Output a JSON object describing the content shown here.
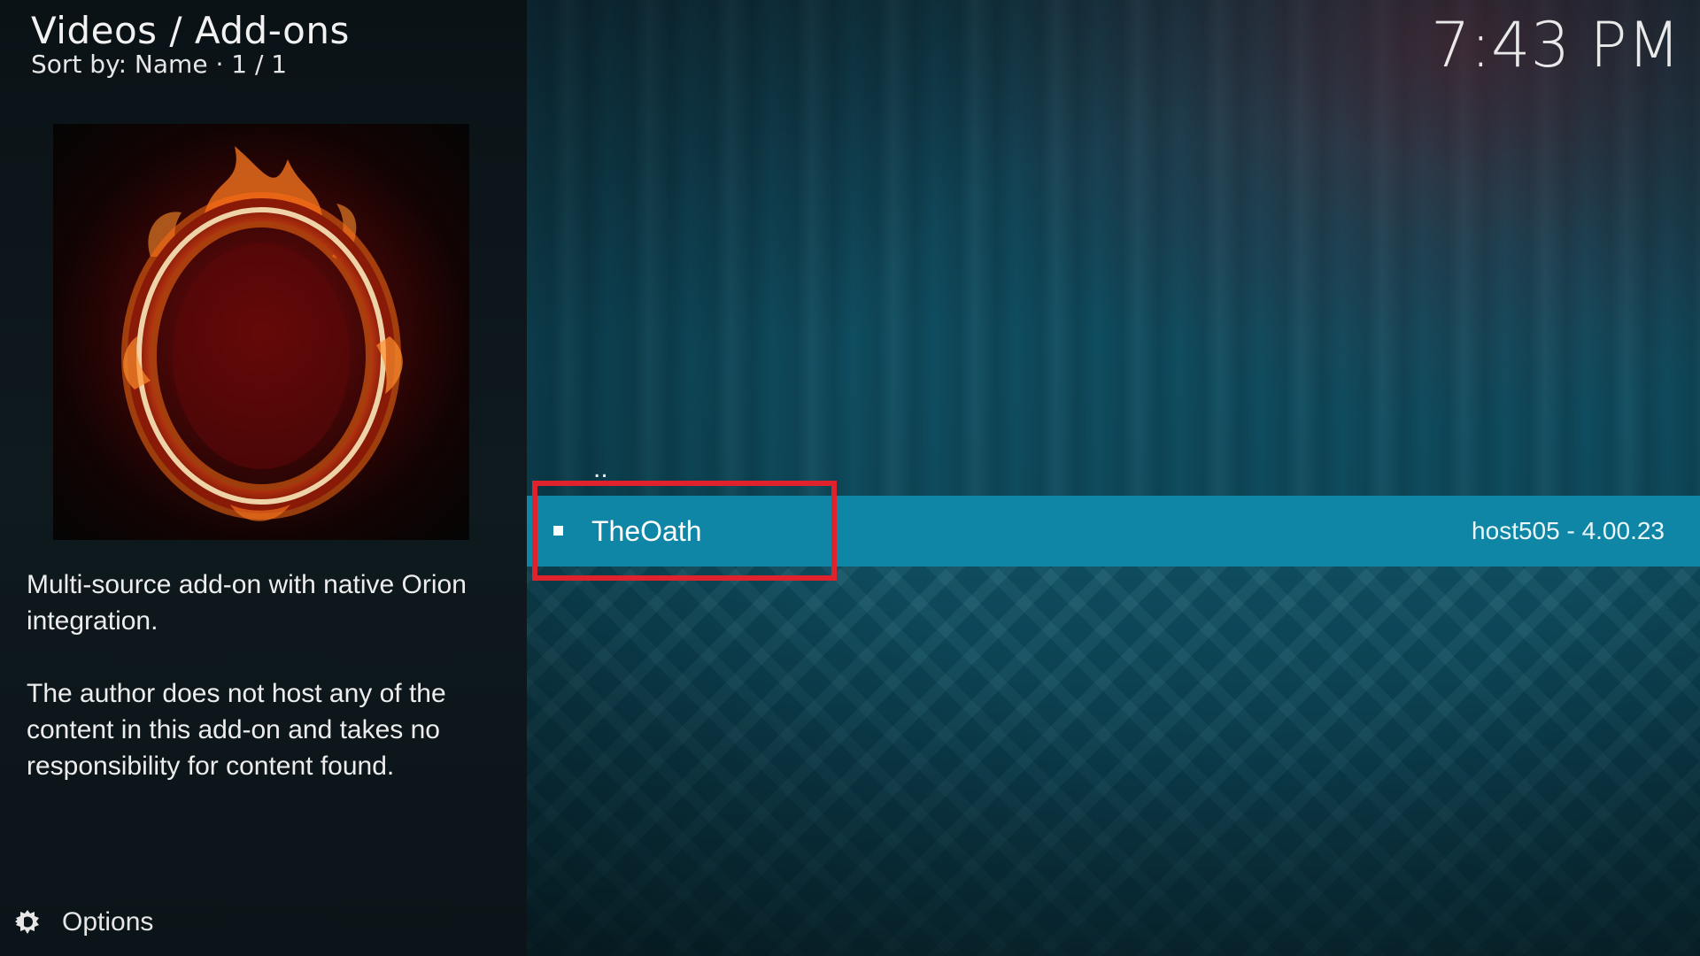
{
  "header": {
    "breadcrumb": "Videos / Add-ons",
    "sort_info": "Sort by: Name  ·  1 / 1",
    "clock": "7:43 PM"
  },
  "addon": {
    "thumbnail_icon": "flaming-o-logo",
    "description": [
      "Multi-source add-on with native Orion integration.",
      "The author does not host any of the content in this add-on and takes no responsibility for content found."
    ]
  },
  "list": {
    "parent_label": "..",
    "items": [
      {
        "label": "TheOath",
        "meta": "host505 - 4.00.23",
        "selected": true
      }
    ]
  },
  "footer": {
    "options_label": "Options",
    "options_icon": "options-icon"
  },
  "colors": {
    "selection": "#0f86a5",
    "highlight_box": "#e0222d"
  }
}
